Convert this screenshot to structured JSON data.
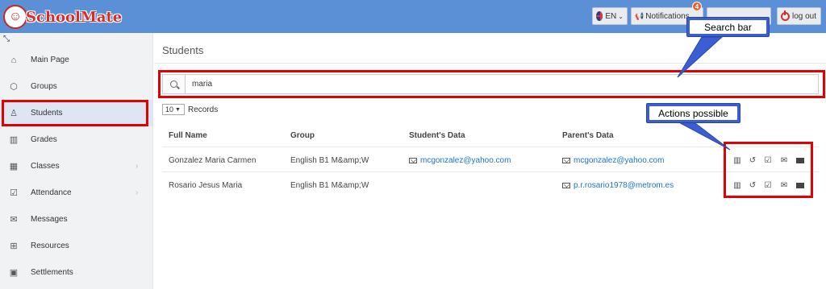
{
  "header": {
    "app_name": "SchoolMate",
    "lang_label": "EN",
    "notifications_label": "Notifications",
    "notifications_count": "4",
    "logout_label": "log out"
  },
  "sidebar": {
    "items": [
      {
        "label": "Main Page",
        "icon": "home-icon"
      },
      {
        "label": "Groups",
        "icon": "cube-icon"
      },
      {
        "label": "Students",
        "icon": "user-icon"
      },
      {
        "label": "Grades",
        "icon": "book-icon"
      },
      {
        "label": "Classes",
        "icon": "calendar-icon"
      },
      {
        "label": "Attendance",
        "icon": "checkbox-icon"
      },
      {
        "label": "Messages",
        "icon": "envelope-icon"
      },
      {
        "label": "Resources",
        "icon": "open-book-icon"
      },
      {
        "label": "Settlements",
        "icon": "money-icon"
      }
    ],
    "active_index": 2
  },
  "main": {
    "page_title": "Students",
    "search_value": "maria",
    "records_value": "10",
    "records_label": "Records",
    "columns": [
      "Full Name",
      "Group",
      "Student's Data",
      "Parent's Data"
    ],
    "rows": [
      {
        "full_name": "Gonzalez Maria Carmen",
        "group": "English B1 M&amp;W",
        "student_email": "mcgonzalez@yahoo.com",
        "parent_email": "mcgonzalez@yahoo.com"
      },
      {
        "full_name": "Rosario Jesus Maria",
        "group": "English B1 M&amp;W",
        "student_email": "",
        "parent_email": "p.r.rosario1978@metrom.es"
      }
    ]
  },
  "annotations": {
    "search_bar": "Search bar",
    "actions": "Actions possible"
  },
  "colors": {
    "topbar": "#5b8fd6",
    "highlight": "#e30000",
    "callout": "#3b5fd3",
    "link": "#1a73c7"
  }
}
